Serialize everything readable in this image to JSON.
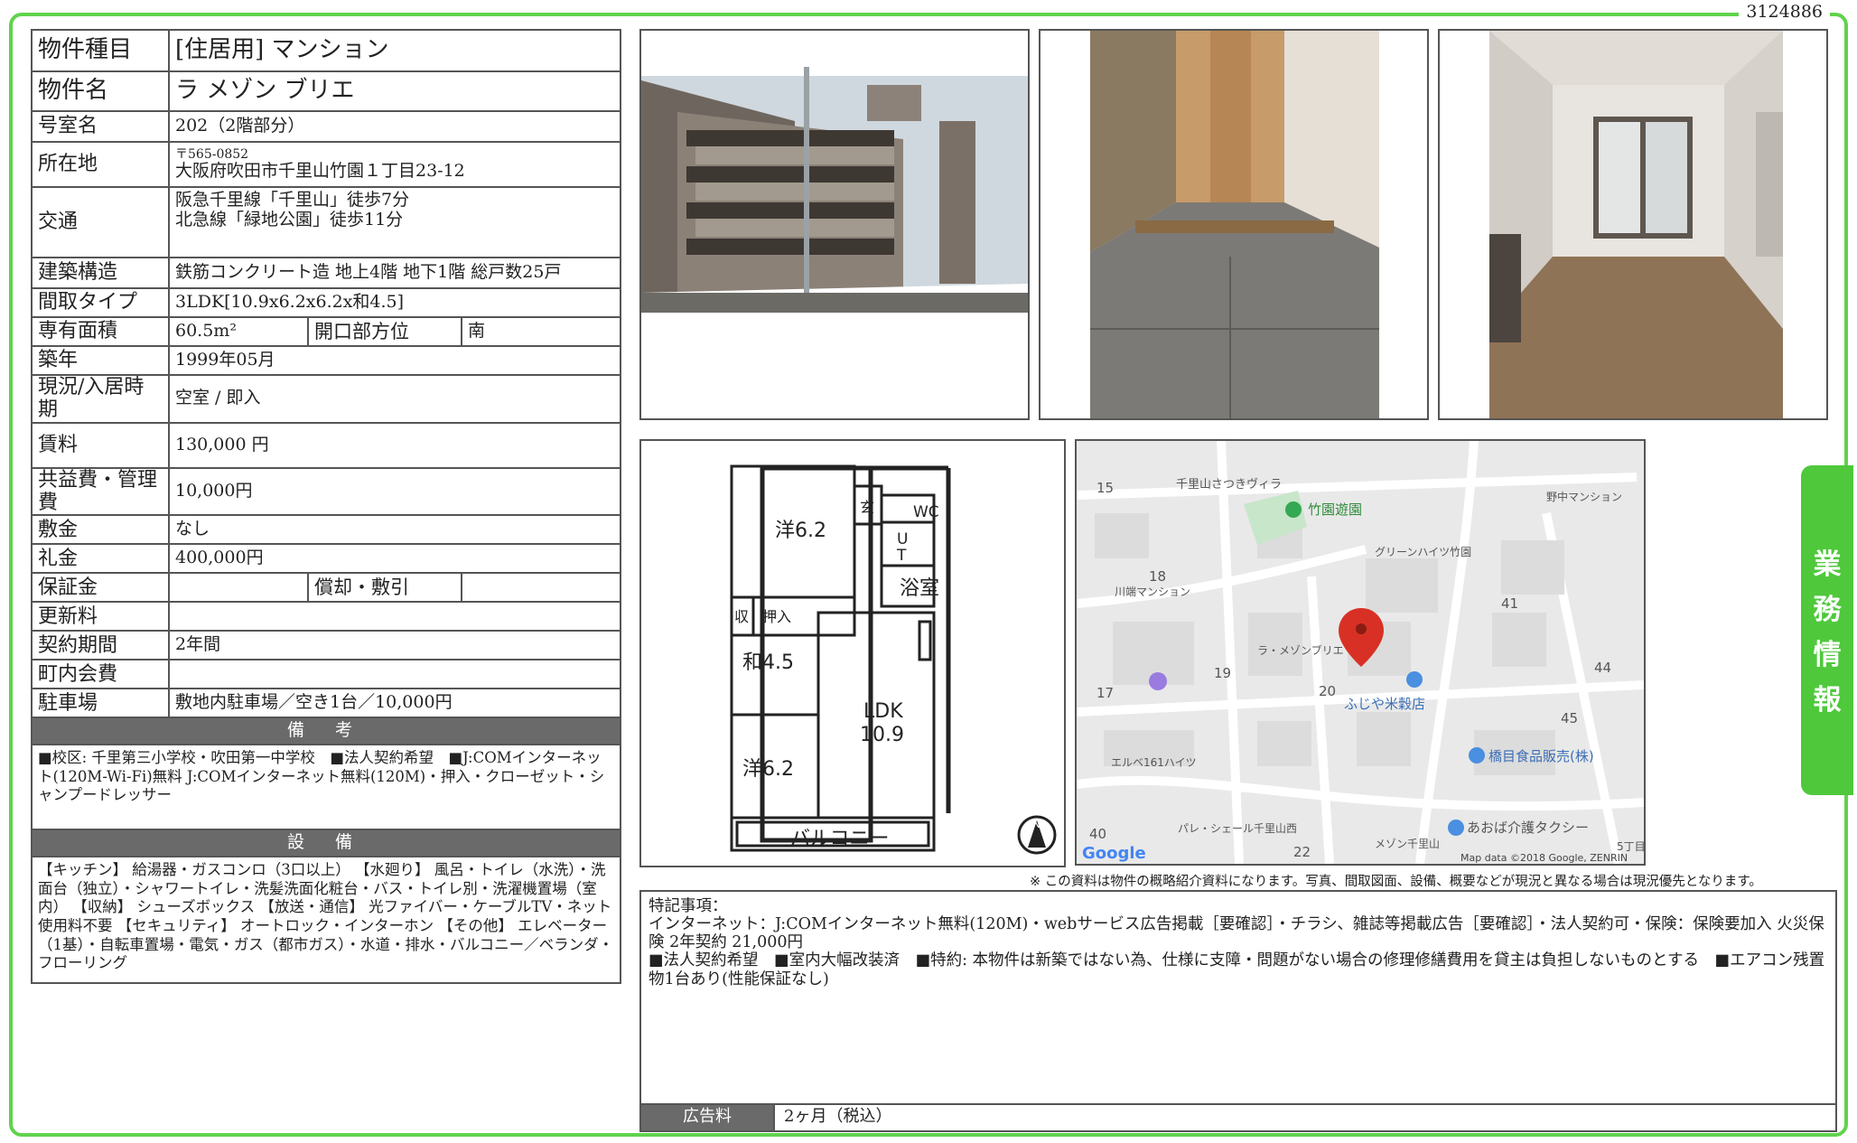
{
  "doc_id": "3124886",
  "side_tab": [
    "業",
    "務",
    "情",
    "報"
  ],
  "rows": {
    "type": {
      "label": "物件種目",
      "value": "[住居用] マンション"
    },
    "name": {
      "label": "物件名",
      "value": "ラ メゾン ブリエ"
    },
    "room": {
      "label": "号室名",
      "value": "202（2階部分）"
    },
    "address": {
      "label": "所在地",
      "zip": "〒565-0852",
      "value": "大阪府吹田市千里山竹園１丁目23-12"
    },
    "access": {
      "label": "交通",
      "line1": "阪急千里線「千里山」徒歩7分",
      "line2": "北急線「緑地公園」徒歩11分"
    },
    "structure": {
      "label": "建築構造",
      "value": "鉄筋コンクリート造 地上4階 地下1階 総戸数25戸"
    },
    "layout": {
      "label": "間取タイプ",
      "value": "3LDK[10.9x6.2x6.2x和4.5]"
    },
    "area": {
      "label": "専有面積",
      "value": "60.5m²",
      "sub_label": "開口部方位",
      "sub_value": "南"
    },
    "built": {
      "label": "築年",
      "value": "1999年05月"
    },
    "status": {
      "label": "現況/入居時期",
      "value": "空室 / 即入"
    },
    "rent": {
      "label": "賃料",
      "value": "130,000 円"
    },
    "fee": {
      "label": "共益費・管理費",
      "value": "10,000円"
    },
    "deposit": {
      "label": "敷金",
      "value": "なし"
    },
    "key_money": {
      "label": "礼金",
      "value": "400,000円"
    },
    "guarantee": {
      "label": "保証金",
      "value": "",
      "sub_label": "償却・敷引",
      "sub_value": ""
    },
    "renewal": {
      "label": "更新料",
      "value": ""
    },
    "contract": {
      "label": "契約期間",
      "value": "2年間"
    },
    "town_fee": {
      "label": "町内会費",
      "value": ""
    },
    "parking": {
      "label": "駐車場",
      "value": "敷地内駐車場／空き1台／10,000円"
    }
  },
  "remarks": {
    "title": "備 考",
    "text": "■校区: 千里第三小学校・吹田第一中学校　■法人契約希望　■J:COMインターネット(120M-Wi-Fi)無料 J:COMインターネット無料(120M)・押入・クローゼット・シャンプードレッサー"
  },
  "facilities": {
    "title": "設 備",
    "text": "【キッチン】 給湯器・ガスコンロ（3口以上） 【水廻り】 風呂・トイレ（水洗）・洗面台（独立）・シャワートイレ・洗髪洗面化粧台・バス・トイレ別・洗濯機置場（室内） 【収納】 シューズボックス 【放送・通信】 光ファイバー・ケーブルTV・ネット使用料不要 【セキュリティ】 オートロック・インターホン 【その他】 エレベーター（1基）・自転車置場・電気・ガス（都市ガス）・水道・排水・バルコニー／ベランダ・フローリング"
  },
  "floorplan": {
    "rooms": [
      "洋6.2",
      "玄",
      "WC",
      "U",
      "T",
      "浴室",
      "収",
      "押入",
      "和4.5",
      "LDK",
      "10.9",
      "洋6.2",
      "バルコニー"
    ],
    "north": "N"
  },
  "map": {
    "labels": [
      "15",
      "千里山さつきヴィラ",
      "竹園遊園",
      "野中マンション",
      "グリーンハイツ竹園",
      "18",
      "川端マンション",
      "41",
      "ラ・メゾンブリエ",
      "19",
      "20",
      "44",
      "17",
      "ふじや米穀店",
      "45",
      "エルベ161ハイツ",
      "橋目食品販売(株)",
      "パレ・シェール千里山西",
      "あおば介護タクシー",
      "40",
      "22",
      "メゾン千里山",
      "5丁目"
    ],
    "brand": "Google",
    "credit": "Map data ©2018 Google, ZENRIN"
  },
  "disclaimer": "※ この資料は物件の概略紹介資料になります。写真、間取図面、設備、概要などが現況と異なる場合は現況優先となります。",
  "special": {
    "title": "特記事項：",
    "line1": "インターネット：J:COMインターネット無料(120M)・webサービス広告掲載［要確認］・チラシ、雑誌等掲載広告［要確認］・法人契約可・保険：保険要加入 火災保険 2年契約 21,000円",
    "line2": "■法人契約希望　■室内大幅改装済　■特約: 本物件は新築ではない為、仕様に支障・問題がない場合の修理修繕費用を貸主は負担しないものとする　■エアコン残置物1台あり(性能保証なし)"
  },
  "ad_fee": {
    "label": "広告料",
    "value": "2ヶ月（税込）"
  },
  "colors": {
    "accent": "#4fc83c",
    "header_gray": "#6a6a6a",
    "pin": "#d93025"
  }
}
